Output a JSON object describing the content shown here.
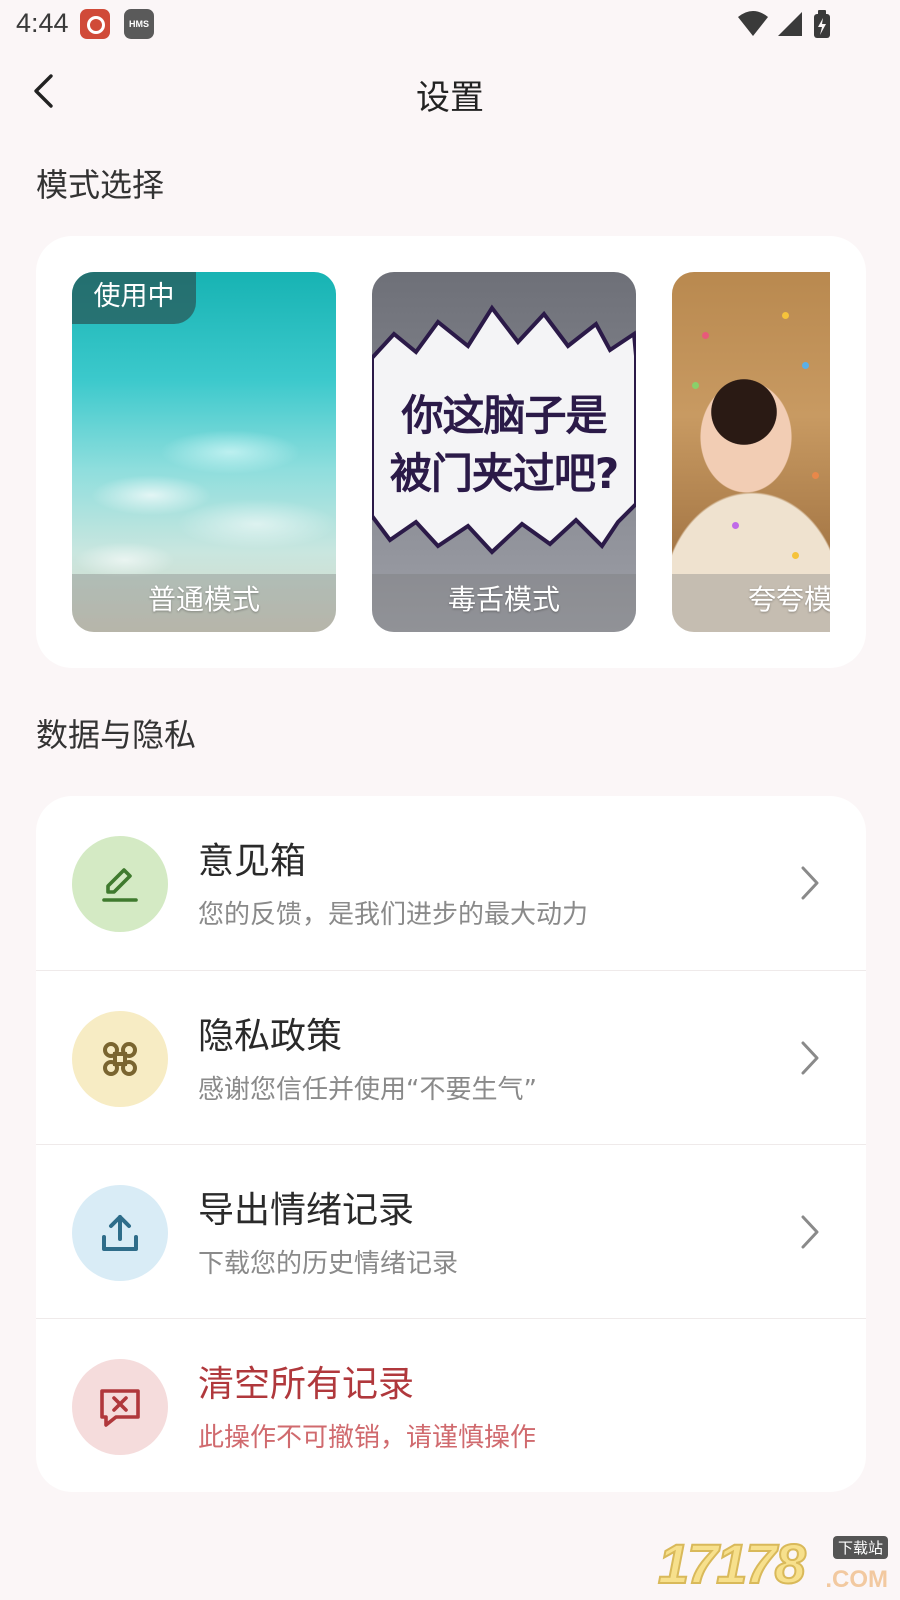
{
  "status_bar": {
    "time": "4:44",
    "app_badge_text": "HMS",
    "icons": [
      "notification-app-icon",
      "hms-icon",
      "wifi-icon",
      "signal-icon",
      "battery-charging-icon"
    ]
  },
  "header": {
    "title": "设置",
    "back_icon": "chevron-left-icon"
  },
  "mode_section": {
    "title": "模式选择",
    "modes": [
      {
        "label": "普通模式",
        "badge": "使用中",
        "active": true,
        "image": "underwater-scene"
      },
      {
        "label": "毒舌模式",
        "bubble_line1": "你这脑子是",
        "bubble_line2": "被门夹过吧?",
        "image": "comic-speech-bubble"
      },
      {
        "label": "夸夸模式",
        "image": "smiling-woman-confetti"
      }
    ]
  },
  "privacy_section": {
    "title": "数据与隐私",
    "items": [
      {
        "title": "意见箱",
        "subtitle": "您的反馈，是我们进步的最大动力",
        "icon": "edit-icon",
        "icon_bg": "#d4eac4",
        "icon_color": "#3f7a2e"
      },
      {
        "title": "隐私政策",
        "subtitle": "感谢您信任并使用“不要生气”",
        "icon": "command-icon",
        "icon_bg": "#f7ecc4",
        "icon_color": "#7a6530"
      },
      {
        "title": "导出情绪记录",
        "subtitle": "下载您的历史情绪记录",
        "icon": "upload-icon",
        "icon_bg": "#d9ecf6",
        "icon_color": "#2f6d8a"
      },
      {
        "title": "清空所有记录",
        "subtitle": "此操作不可撤销，请谨慎操作",
        "icon": "delete-message-icon",
        "icon_bg": "#f5dcdc",
        "icon_color": "#b0383c",
        "danger": true
      }
    ]
  },
  "watermark": {
    "number": "17178",
    "tag": "下载站",
    "domain": ".COM"
  }
}
